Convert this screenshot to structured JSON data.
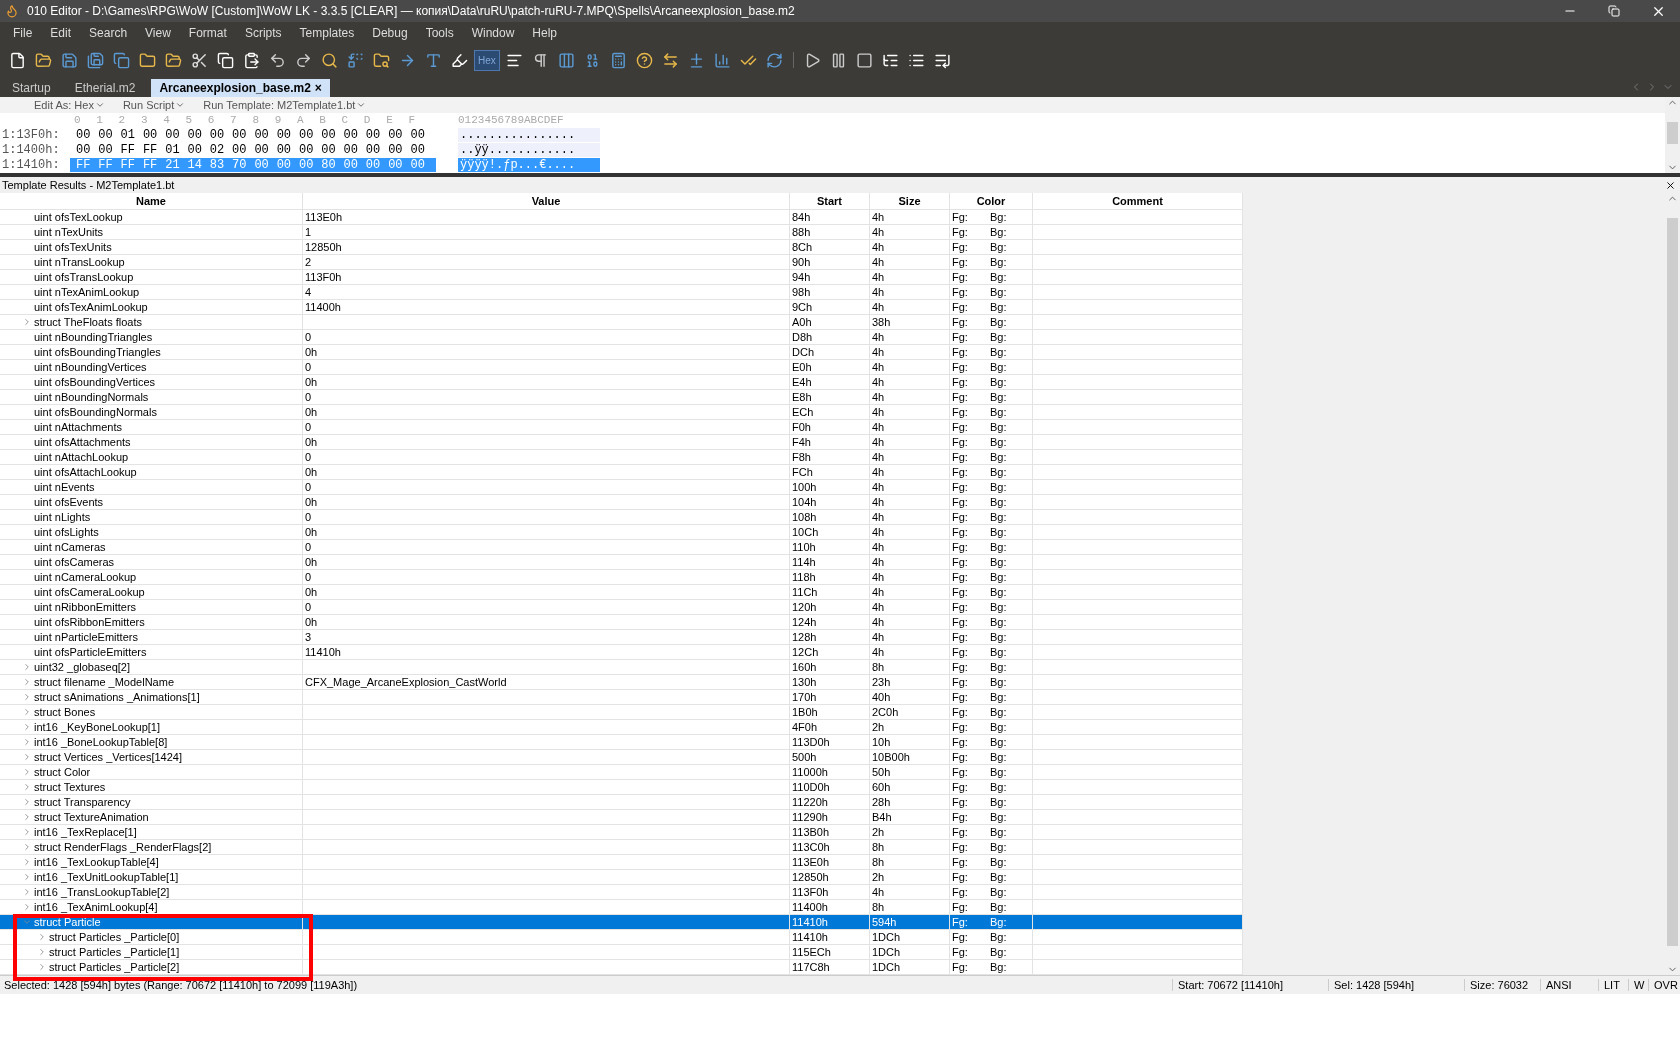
{
  "window": {
    "title": "010 Editor - D:\\Games\\RPG\\WoW [Custom]\\WoW LK - 3.3.5 [CLEAR] — копия\\Data\\ruRU\\patch-ruRU-7.MPQ\\Spells\\Arcaneexplosion_base.m2"
  },
  "menu": [
    "File",
    "Edit",
    "Search",
    "View",
    "Format",
    "Scripts",
    "Templates",
    "Debug",
    "Tools",
    "Window",
    "Help"
  ],
  "toolbar": {
    "hex_label": "Hex",
    "hex_on": true
  },
  "tabs": [
    {
      "label": "Startup",
      "selected": false
    },
    {
      "label": "Etherial.m2",
      "selected": false
    },
    {
      "label": "Arcaneexplosion_base.m2",
      "selected": true,
      "close": "×"
    }
  ],
  "hex_toolbar": [
    "Edit As: Hex",
    "Run Script",
    "Run Template: M2Template1.bt"
  ],
  "hex": {
    "columns": [
      "0",
      "1",
      "2",
      "3",
      "4",
      "5",
      "6",
      "7",
      "8",
      "9",
      "A",
      "B",
      "C",
      "D",
      "E",
      "F"
    ],
    "ascii_header": "0123456789ABCDEF",
    "rows": [
      {
        "address": "1:13F0h:",
        "bytes": [
          "00",
          "00",
          "01",
          "00",
          "00",
          "00",
          "00",
          "00",
          "00",
          "00",
          "00",
          "00",
          "00",
          "00",
          "00",
          "00"
        ],
        "ascii": "................",
        "selected": false
      },
      {
        "address": "1:1400h:",
        "bytes": [
          "00",
          "00",
          "FF",
          "FF",
          "01",
          "00",
          "02",
          "00",
          "00",
          "00",
          "00",
          "00",
          "00",
          "00",
          "00",
          "00"
        ],
        "ascii": "..ÿÿ............",
        "selected": false
      },
      {
        "address": "1:1410h:",
        "bytes": [
          "FF",
          "FF",
          "FF",
          "FF",
          "21",
          "14",
          "83",
          "70",
          "00",
          "00",
          "00",
          "80",
          "00",
          "00",
          "00",
          "00"
        ],
        "ascii": "ÿÿÿÿ!.ƒp...€....",
        "selected": true
      }
    ]
  },
  "template": {
    "title": "Template Results - M2Template1.bt",
    "columns": [
      "Name",
      "Value",
      "Start",
      "Size",
      "Color",
      "Comment"
    ],
    "rows": [
      {
        "kind": "field",
        "name": "uint ofsTexLookup",
        "value": "113E0h",
        "start": "84h",
        "size": "4h",
        "fg": "Fg:",
        "bg": "Bg:",
        "selected": false
      },
      {
        "kind": "field",
        "name": "uint nTexUnits",
        "value": "1",
        "start": "88h",
        "size": "4h",
        "fg": "Fg:",
        "bg": "Bg:",
        "selected": false
      },
      {
        "kind": "field",
        "name": "uint ofsTexUnits",
        "value": "12850h",
        "start": "8Ch",
        "size": "4h",
        "fg": "Fg:",
        "bg": "Bg:",
        "selected": false
      },
      {
        "kind": "field",
        "name": "uint nTransLookup",
        "value": "2",
        "start": "90h",
        "size": "4h",
        "fg": "Fg:",
        "bg": "Bg:",
        "selected": false
      },
      {
        "kind": "field",
        "name": "uint ofsTransLookup",
        "value": "113F0h",
        "start": "94h",
        "size": "4h",
        "fg": "Fg:",
        "bg": "Bg:",
        "selected": false
      },
      {
        "kind": "field",
        "name": "uint nTexAnimLookup",
        "value": "4",
        "start": "98h",
        "size": "4h",
        "fg": "Fg:",
        "bg": "Bg:",
        "selected": false
      },
      {
        "kind": "field",
        "name": "uint ofsTexAnimLookup",
        "value": "11400h",
        "start": "9Ch",
        "size": "4h",
        "fg": "Fg:",
        "bg": "Bg:",
        "selected": false
      },
      {
        "kind": "struct",
        "name": "struct TheFloats floats",
        "start": "A0h",
        "size": "38h",
        "fg": "Fg:",
        "bg": "Bg:",
        "expanded": false,
        "selected": false
      },
      {
        "kind": "field",
        "name": "uint nBoundingTriangles",
        "value": "0",
        "start": "D8h",
        "size": "4h",
        "fg": "Fg:",
        "bg": "Bg:",
        "selected": false
      },
      {
        "kind": "field",
        "name": "uint ofsBoundingTriangles",
        "value": "0h",
        "start": "DCh",
        "size": "4h",
        "fg": "Fg:",
        "bg": "Bg:",
        "selected": false
      },
      {
        "kind": "field",
        "name": "uint nBoundingVertices",
        "value": "0",
        "start": "E0h",
        "size": "4h",
        "fg": "Fg:",
        "bg": "Bg:",
        "selected": false
      },
      {
        "kind": "field",
        "name": "uint ofsBoundingVertices",
        "value": "0h",
        "start": "E4h",
        "size": "4h",
        "fg": "Fg:",
        "bg": "Bg:",
        "selected": false
      },
      {
        "kind": "field",
        "name": "uint nBoundingNormals",
        "value": "0",
        "start": "E8h",
        "size": "4h",
        "fg": "Fg:",
        "bg": "Bg:",
        "selected": false
      },
      {
        "kind": "field",
        "name": "uint ofsBoundingNormals",
        "value": "0h",
        "start": "ECh",
        "size": "4h",
        "fg": "Fg:",
        "bg": "Bg:",
        "selected": false
      },
      {
        "kind": "field",
        "name": "uint nAttachments",
        "value": "0",
        "start": "F0h",
        "size": "4h",
        "fg": "Fg:",
        "bg": "Bg:",
        "selected": false
      },
      {
        "kind": "field",
        "name": "uint ofsAttachments",
        "value": "0h",
        "start": "F4h",
        "size": "4h",
        "fg": "Fg:",
        "bg": "Bg:",
        "selected": false
      },
      {
        "kind": "field",
        "name": "uint nAttachLookup",
        "value": "0",
        "start": "F8h",
        "size": "4h",
        "fg": "Fg:",
        "bg": "Bg:",
        "selected": false
      },
      {
        "kind": "field",
        "name": "uint ofsAttachLookup",
        "value": "0h",
        "start": "FCh",
        "size": "4h",
        "fg": "Fg:",
        "bg": "Bg:",
        "selected": false
      },
      {
        "kind": "field",
        "name": "uint nEvents",
        "value": "0",
        "start": "100h",
        "size": "4h",
        "fg": "Fg:",
        "bg": "Bg:",
        "selected": false
      },
      {
        "kind": "field",
        "name": "uint ofsEvents",
        "value": "0h",
        "start": "104h",
        "size": "4h",
        "fg": "Fg:",
        "bg": "Bg:",
        "selected": false
      },
      {
        "kind": "field",
        "name": "uint nLights",
        "value": "0",
        "start": "108h",
        "size": "4h",
        "fg": "Fg:",
        "bg": "Bg:",
        "selected": false
      },
      {
        "kind": "field",
        "name": "uint ofsLights",
        "value": "0h",
        "start": "10Ch",
        "size": "4h",
        "fg": "Fg:",
        "bg": "Bg:",
        "selected": false
      },
      {
        "kind": "field",
        "name": "uint nCameras",
        "value": "0",
        "start": "110h",
        "size": "4h",
        "fg": "Fg:",
        "bg": "Bg:",
        "selected": false
      },
      {
        "kind": "field",
        "name": "uint ofsCameras",
        "value": "0h",
        "start": "114h",
        "size": "4h",
        "fg": "Fg:",
        "bg": "Bg:",
        "selected": false
      },
      {
        "kind": "field",
        "name": "uint nCameraLookup",
        "value": "0",
        "start": "118h",
        "size": "4h",
        "fg": "Fg:",
        "bg": "Bg:",
        "selected": false
      },
      {
        "kind": "field",
        "name": "uint ofsCameraLookup",
        "value": "0h",
        "start": "11Ch",
        "size": "4h",
        "fg": "Fg:",
        "bg": "Bg:",
        "selected": false
      },
      {
        "kind": "field",
        "name": "uint nRibbonEmitters",
        "value": "0",
        "start": "120h",
        "size": "4h",
        "fg": "Fg:",
        "bg": "Bg:",
        "selected": false
      },
      {
        "kind": "field",
        "name": "uint ofsRibbonEmitters",
        "value": "0h",
        "start": "124h",
        "size": "4h",
        "fg": "Fg:",
        "bg": "Bg:",
        "selected": false
      },
      {
        "kind": "field",
        "name": "uint nParticleEmitters",
        "value": "3",
        "start": "128h",
        "size": "4h",
        "fg": "Fg:",
        "bg": "Bg:",
        "selected": false
      },
      {
        "kind": "field",
        "name": "uint ofsParticleEmitters",
        "value": "11410h",
        "start": "12Ch",
        "size": "4h",
        "fg": "Fg:",
        "bg": "Bg:",
        "selected": false
      },
      {
        "kind": "struct",
        "name": "uint32 _globaseq[2]",
        "start": "160h",
        "size": "8h",
        "fg": "Fg:",
        "bg": "Bg:",
        "expanded": false,
        "selected": false
      },
      {
        "kind": "struct",
        "name": "struct filename _ModelName",
        "value": "CFX_Mage_ArcaneExplosion_CastWorld",
        "start": "130h",
        "size": "23h",
        "fg": "Fg:",
        "bg": "Bg:",
        "expanded": false,
        "selected": false
      },
      {
        "kind": "struct",
        "name": "struct sAnimations _Animations[1]",
        "start": "170h",
        "size": "40h",
        "fg": "Fg:",
        "bg": "Bg:",
        "expanded": false,
        "selected": false
      },
      {
        "kind": "struct",
        "name": "struct Bones",
        "start": "1B0h",
        "size": "2C0h",
        "fg": "Fg:",
        "bg": "Bg:",
        "expanded": false,
        "selected": false
      },
      {
        "kind": "struct",
        "name": "int16 _KeyBoneLookup[1]",
        "start": "4F0h",
        "size": "2h",
        "fg": "Fg:",
        "bg": "Bg:",
        "expanded": false,
        "selected": false
      },
      {
        "kind": "struct",
        "name": "int16 _BoneLookupTable[8]",
        "start": "113D0h",
        "size": "10h",
        "fg": "Fg:",
        "bg": "Bg:",
        "expanded": false,
        "selected": false
      },
      {
        "kind": "struct",
        "name": "struct Vertices _Vertices[1424]",
        "start": "500h",
        "size": "10B00h",
        "fg": "Fg:",
        "bg": "Bg:",
        "expanded": false,
        "selected": false
      },
      {
        "kind": "struct",
        "name": "struct Color",
        "start": "11000h",
        "size": "50h",
        "fg": "Fg:",
        "bg": "Bg:",
        "expanded": false,
        "selected": false
      },
      {
        "kind": "struct",
        "name": "struct Textures",
        "start": "110D0h",
        "size": "60h",
        "fg": "Fg:",
        "bg": "Bg:",
        "expanded": false,
        "selected": false
      },
      {
        "kind": "struct",
        "name": "struct Transparency",
        "start": "11220h",
        "size": "28h",
        "fg": "Fg:",
        "bg": "Bg:",
        "expanded": false,
        "selected": false
      },
      {
        "kind": "struct",
        "name": "struct TextureAnimation",
        "start": "11290h",
        "size": "B4h",
        "fg": "Fg:",
        "bg": "Bg:",
        "expanded": false,
        "selected": false
      },
      {
        "kind": "struct",
        "name": "int16 _TexReplace[1]",
        "start": "113B0h",
        "size": "2h",
        "fg": "Fg:",
        "bg": "Bg:",
        "expanded": false,
        "selected": false
      },
      {
        "kind": "struct",
        "name": "struct RenderFlags _RenderFlags[2]",
        "start": "113C0h",
        "size": "8h",
        "fg": "Fg:",
        "bg": "Bg:",
        "expanded": false,
        "selected": false
      },
      {
        "kind": "struct",
        "name": "int16 _TexLookupTable[4]",
        "start": "113E0h",
        "size": "8h",
        "fg": "Fg:",
        "bg": "Bg:",
        "expanded": false,
        "selected": false
      },
      {
        "kind": "struct",
        "name": "int16 _TexUnitLookupTable[1]",
        "start": "12850h",
        "size": "2h",
        "fg": "Fg:",
        "bg": "Bg:",
        "expanded": false,
        "selected": false
      },
      {
        "kind": "struct",
        "name": "int16 _TransLookupTable[2]",
        "start": "113F0h",
        "size": "4h",
        "fg": "Fg:",
        "bg": "Bg:",
        "expanded": false,
        "selected": false
      },
      {
        "kind": "struct",
        "name": "int16 _TexAnimLookup[4]",
        "start": "11400h",
        "size": "8h",
        "fg": "Fg:",
        "bg": "Bg:",
        "expanded": false,
        "selected": false
      },
      {
        "kind": "struct",
        "name": "struct Particle",
        "start": "11410h",
        "size": "594h",
        "fg": "Fg:",
        "bg": "Bg:",
        "expanded": true,
        "selected": true,
        "children": [
          {
            "kind": "struct",
            "name": "struct Particles _Particle[0]",
            "start": "11410h",
            "size": "1DCh",
            "fg": "Fg:",
            "bg": "Bg:",
            "expanded": false,
            "selected": false
          },
          {
            "kind": "struct",
            "name": "struct Particles _Particle[1]",
            "start": "115ECh",
            "size": "1DCh",
            "fg": "Fg:",
            "bg": "Bg:",
            "expanded": false,
            "selected": false
          },
          {
            "kind": "struct",
            "name": "struct Particles _Particle[2]",
            "start": "117C8h",
            "size": "1DCh",
            "fg": "Fg:",
            "bg": "Bg:",
            "expanded": false,
            "selected": false
          }
        ]
      }
    ]
  },
  "status_bar": {
    "selection": "Selected: 1428 [594h] bytes (Range: 70672 [11410h] to 72099 [119A3h])",
    "start": "Start: 70672 [11410h]",
    "sel": "Sel: 1428 [594h]",
    "size": "Size: 76032",
    "encoding": "ANSI",
    "endian": "LIT",
    "mode_w": "W",
    "overwrite": "OVR"
  }
}
